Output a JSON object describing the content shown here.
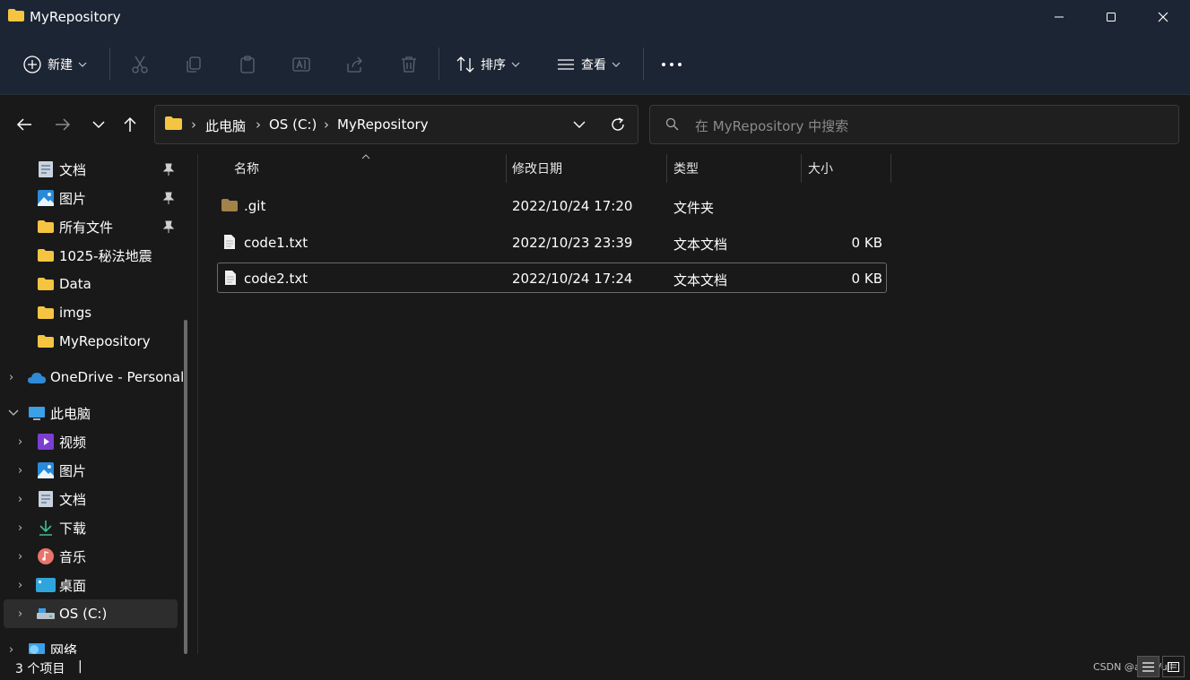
{
  "window": {
    "title": "MyRepository"
  },
  "toolbar": {
    "new_label": "新建",
    "sort_label": "排序",
    "view_label": "查看"
  },
  "address": {
    "segments": [
      "此电脑",
      "OS (C:)",
      "MyRepository"
    ]
  },
  "search": {
    "placeholder": "在 MyRepository 中搜索"
  },
  "sidebar": {
    "quick": [
      {
        "label": "文档",
        "icon": "documents-icon",
        "pinned": true
      },
      {
        "label": "图片",
        "icon": "pictures-icon",
        "pinned": true
      },
      {
        "label": "所有文件",
        "icon": "folder-icon",
        "pinned": true
      },
      {
        "label": "1025-秘法地震",
        "icon": "folder-icon",
        "pinned": false
      },
      {
        "label": "Data",
        "icon": "folder-icon",
        "pinned": false
      },
      {
        "label": "imgs",
        "icon": "folder-icon",
        "pinned": false
      },
      {
        "label": "MyRepository",
        "icon": "folder-icon",
        "pinned": false
      }
    ],
    "onedrive": "OneDrive - Personal",
    "thispc": "此电脑",
    "pc_items": [
      {
        "label": "视频",
        "icon": "videos-icon"
      },
      {
        "label": "图片",
        "icon": "pictures-icon"
      },
      {
        "label": "文档",
        "icon": "documents-icon"
      },
      {
        "label": "下载",
        "icon": "downloads-icon"
      },
      {
        "label": "音乐",
        "icon": "music-icon"
      },
      {
        "label": "桌面",
        "icon": "desktop-icon"
      },
      {
        "label": "OS (C:)",
        "icon": "drive-icon"
      }
    ],
    "network": "网络"
  },
  "columns": {
    "name": "名称",
    "modified": "修改日期",
    "type": "类型",
    "size": "大小"
  },
  "files": [
    {
      "name": ".git",
      "modified": "2022/10/24 17:20",
      "type": "文件夹",
      "size": "",
      "icon": "folder-icon"
    },
    {
      "name": "code1.txt",
      "modified": "2022/10/23 23:39",
      "type": "文本文档",
      "size": "0 KB",
      "icon": "text-file-icon"
    },
    {
      "name": "code2.txt",
      "modified": "2022/10/24 17:24",
      "type": "文本文档",
      "size": "0 KB",
      "icon": "text-file-icon"
    }
  ],
  "status": {
    "count": "3 个项目",
    "watermark": "CSDN @asBlVull"
  },
  "colors": {
    "titlebar": "#1c2533",
    "background": "#191919",
    "folder": "#f5c542",
    "accent": "#4cc2ff"
  }
}
